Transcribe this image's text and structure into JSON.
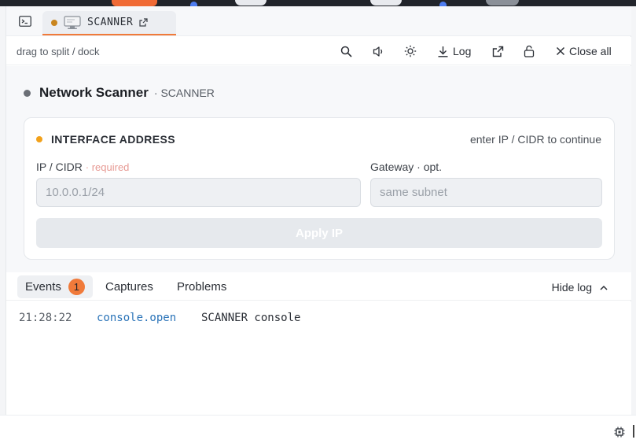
{
  "tab": {
    "label": "SCANNER",
    "popout_icon": "external-link-icon"
  },
  "toolbar": {
    "drag_hint": "drag to split / dock",
    "log_label": "Log",
    "close_all_label": "Close all"
  },
  "scanner": {
    "title": "Network Scanner",
    "subtitle": "· SCANNER"
  },
  "card": {
    "title": "INTERFACE ADDRESS",
    "hint": "enter IP / CIDR to continue",
    "ip_label": "IP / CIDR",
    "ip_required": "· required",
    "ip_placeholder": "10.0.0.1/24",
    "gateway_label": "Gateway · opt.",
    "gateway_placeholder": "same subnet",
    "apply_label": "Apply IP"
  },
  "log_tabs": {
    "events_label": "Events",
    "events_count": "1",
    "captures_label": "Captures",
    "problems_label": "Problems",
    "hide_log_label": "Hide log"
  },
  "log_entries": [
    {
      "time": "21:28:22",
      "event": "console.open",
      "message": "SCANNER console"
    }
  ],
  "colors": {
    "accent": "#f07a3a",
    "warning_dot": "#f2a11a",
    "event_blue": "#2a73b8",
    "required_red": "#e79a94"
  }
}
